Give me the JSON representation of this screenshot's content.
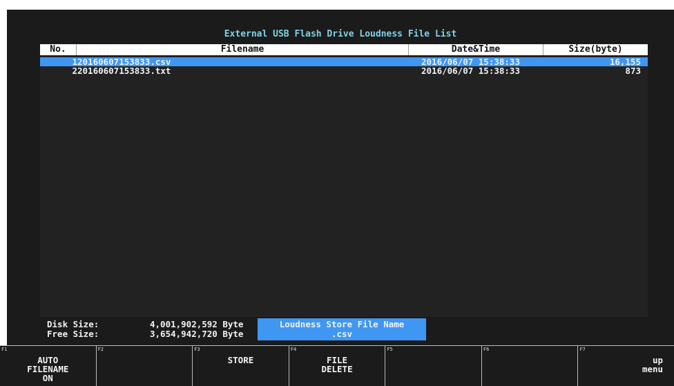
{
  "title": "External USB Flash Drive Loudness File List",
  "table": {
    "columns": [
      "No.",
      "Filename",
      "Date&Time",
      "Size(byte)"
    ],
    "rows": [
      {
        "no": "1",
        "filename": "20160607153833.csv",
        "datetime": "2016/06/07 15:38:33",
        "size": "16,155",
        "selected": true
      },
      {
        "no": "2",
        "filename": "20160607153833.txt",
        "datetime": "2016/06/07 15:38:33",
        "size": "873",
        "selected": false
      }
    ]
  },
  "disk": {
    "disk_size_label": "Disk Size:",
    "disk_size_value": "4,001,902,592 Byte",
    "free_size_label": "Free Size:",
    "free_size_value": "3,654,942,720 Byte"
  },
  "store_file": {
    "label": "Loudness Store File Name",
    "value": ".csv"
  },
  "function_keys": [
    {
      "key": "F1",
      "label": "AUTO\nFILENAME\nON"
    },
    {
      "key": "F2",
      "label": ""
    },
    {
      "key": "F3",
      "label": "STORE"
    },
    {
      "key": "F4",
      "label": "FILE\nDELETE"
    },
    {
      "key": "F5",
      "label": ""
    },
    {
      "key": "F6",
      "label": ""
    },
    {
      "key": "F7",
      "label": "up\nmenu"
    }
  ],
  "colors": {
    "background": "#1b1b1b",
    "title": "#7fd3e6",
    "selection": "#3f97f3",
    "header_bg": "#ffffff"
  }
}
